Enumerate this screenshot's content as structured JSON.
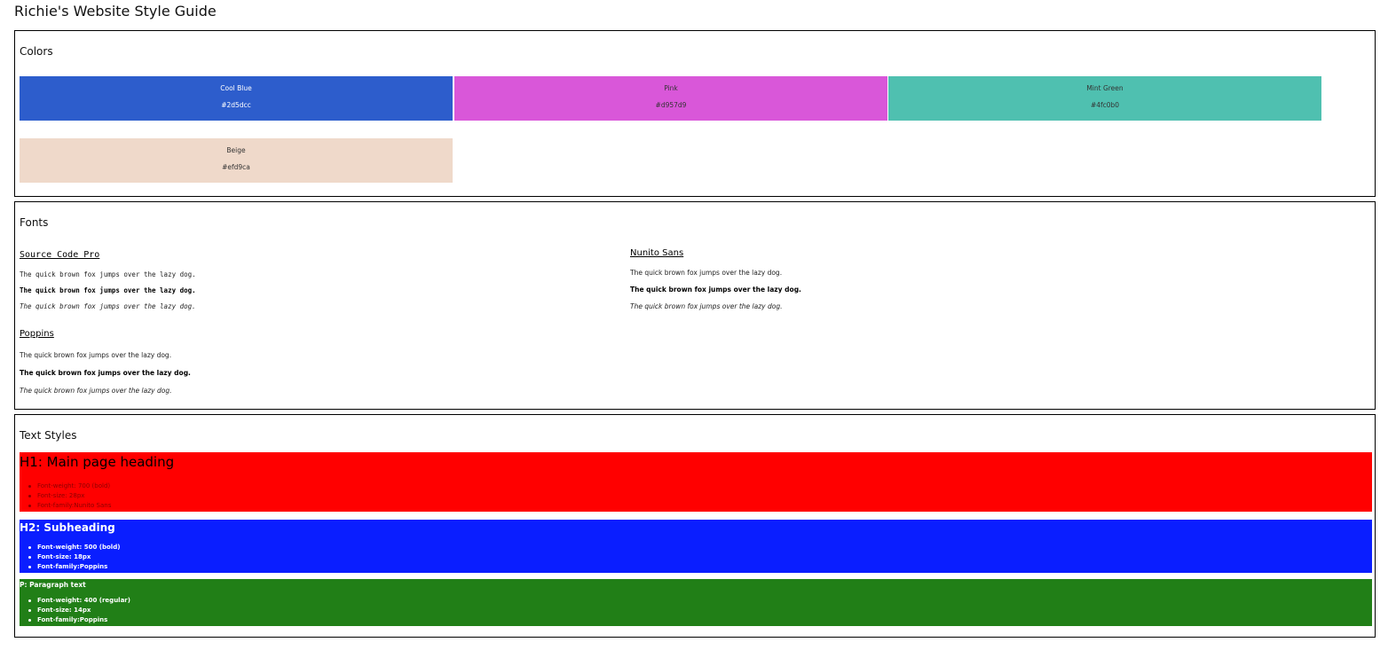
{
  "page": {
    "title": "Richie's Website Style Guide"
  },
  "colors": {
    "title": "Colors",
    "swatches": [
      {
        "name": "Cool Blue",
        "hex": "#2d5dcc",
        "text_color": "#ffffff"
      },
      {
        "name": "Pink",
        "hex": "#d957d9",
        "text_color": "#333333"
      },
      {
        "name": "Mint Green",
        "hex": "#4fc0b0",
        "text_color": "#333333"
      },
      {
        "name": "Beige",
        "hex": "#efd9ca",
        "text_color": "#333333"
      }
    ]
  },
  "fonts": {
    "title": "Fonts",
    "families": [
      {
        "name": "Source Code Pro",
        "samples": [
          "The quick brown fox jumps over the lazy dog.",
          "The quick brown fox jumps over the lazy dog.",
          "The quick brown fox jumps over the lazy dog."
        ]
      },
      {
        "name": "Nunito Sans",
        "samples": [
          "The quick brown fox jumps over the lazy dog.",
          "The quick brown fox jumps over the lazy dog.",
          "The quick brown fox jumps over the lazy dog."
        ]
      },
      {
        "name": "Poppins",
        "samples": [
          "The quick brown fox jumps over the lazy dog.",
          "The quick brown fox jumps over the lazy dog.",
          "The quick brown fox jumps over the lazy dog."
        ]
      }
    ]
  },
  "text_styles": {
    "title": "Text Styles",
    "styles": [
      {
        "heading": "H1: Main page heading",
        "background": "#ff0000",
        "text_color": "#000000",
        "list_color": "#8b0000",
        "props": [
          "Font-weight: 700 (bold)",
          "Font-size: 28px",
          "Font-family:Nunito Sans"
        ]
      },
      {
        "heading": "H2: Subheading",
        "background": "#0a1eff",
        "text_color": "#ffffff",
        "list_color": "#ffffff",
        "props": [
          "Font-weight: 500 (bold)",
          "Font-size: 18px",
          "Font-family:Poppins"
        ]
      },
      {
        "heading": "P: Paragraph text",
        "background": "#217f17",
        "text_color": "#ffffff",
        "list_color": "#ffffff",
        "props": [
          "Font-weight: 400 (regular)",
          "Font-size: 14px",
          "Font-family:Poppins"
        ]
      }
    ]
  }
}
